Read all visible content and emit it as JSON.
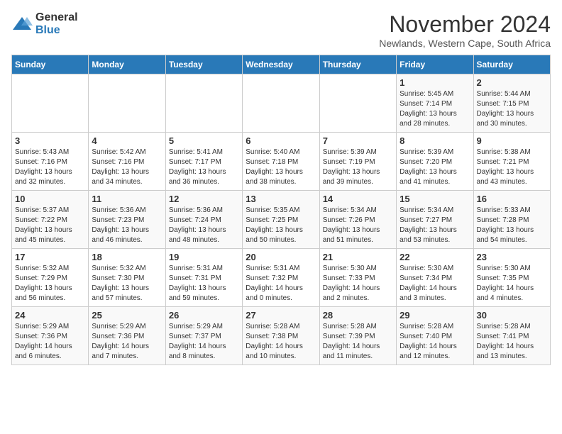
{
  "header": {
    "logo_general": "General",
    "logo_blue": "Blue",
    "month": "November 2024",
    "location": "Newlands, Western Cape, South Africa"
  },
  "days_of_week": [
    "Sunday",
    "Monday",
    "Tuesday",
    "Wednesday",
    "Thursday",
    "Friday",
    "Saturday"
  ],
  "weeks": [
    {
      "days": [
        {
          "number": "",
          "info": ""
        },
        {
          "number": "",
          "info": ""
        },
        {
          "number": "",
          "info": ""
        },
        {
          "number": "",
          "info": ""
        },
        {
          "number": "",
          "info": ""
        },
        {
          "number": "1",
          "info": "Sunrise: 5:45 AM\nSunset: 7:14 PM\nDaylight: 13 hours\nand 28 minutes."
        },
        {
          "number": "2",
          "info": "Sunrise: 5:44 AM\nSunset: 7:15 PM\nDaylight: 13 hours\nand 30 minutes."
        }
      ]
    },
    {
      "days": [
        {
          "number": "3",
          "info": "Sunrise: 5:43 AM\nSunset: 7:16 PM\nDaylight: 13 hours\nand 32 minutes."
        },
        {
          "number": "4",
          "info": "Sunrise: 5:42 AM\nSunset: 7:16 PM\nDaylight: 13 hours\nand 34 minutes."
        },
        {
          "number": "5",
          "info": "Sunrise: 5:41 AM\nSunset: 7:17 PM\nDaylight: 13 hours\nand 36 minutes."
        },
        {
          "number": "6",
          "info": "Sunrise: 5:40 AM\nSunset: 7:18 PM\nDaylight: 13 hours\nand 38 minutes."
        },
        {
          "number": "7",
          "info": "Sunrise: 5:39 AM\nSunset: 7:19 PM\nDaylight: 13 hours\nand 39 minutes."
        },
        {
          "number": "8",
          "info": "Sunrise: 5:39 AM\nSunset: 7:20 PM\nDaylight: 13 hours\nand 41 minutes."
        },
        {
          "number": "9",
          "info": "Sunrise: 5:38 AM\nSunset: 7:21 PM\nDaylight: 13 hours\nand 43 minutes."
        }
      ]
    },
    {
      "days": [
        {
          "number": "10",
          "info": "Sunrise: 5:37 AM\nSunset: 7:22 PM\nDaylight: 13 hours\nand 45 minutes."
        },
        {
          "number": "11",
          "info": "Sunrise: 5:36 AM\nSunset: 7:23 PM\nDaylight: 13 hours\nand 46 minutes."
        },
        {
          "number": "12",
          "info": "Sunrise: 5:36 AM\nSunset: 7:24 PM\nDaylight: 13 hours\nand 48 minutes."
        },
        {
          "number": "13",
          "info": "Sunrise: 5:35 AM\nSunset: 7:25 PM\nDaylight: 13 hours\nand 50 minutes."
        },
        {
          "number": "14",
          "info": "Sunrise: 5:34 AM\nSunset: 7:26 PM\nDaylight: 13 hours\nand 51 minutes."
        },
        {
          "number": "15",
          "info": "Sunrise: 5:34 AM\nSunset: 7:27 PM\nDaylight: 13 hours\nand 53 minutes."
        },
        {
          "number": "16",
          "info": "Sunrise: 5:33 AM\nSunset: 7:28 PM\nDaylight: 13 hours\nand 54 minutes."
        }
      ]
    },
    {
      "days": [
        {
          "number": "17",
          "info": "Sunrise: 5:32 AM\nSunset: 7:29 PM\nDaylight: 13 hours\nand 56 minutes."
        },
        {
          "number": "18",
          "info": "Sunrise: 5:32 AM\nSunset: 7:30 PM\nDaylight: 13 hours\nand 57 minutes."
        },
        {
          "number": "19",
          "info": "Sunrise: 5:31 AM\nSunset: 7:31 PM\nDaylight: 13 hours\nand 59 minutes."
        },
        {
          "number": "20",
          "info": "Sunrise: 5:31 AM\nSunset: 7:32 PM\nDaylight: 14 hours\nand 0 minutes."
        },
        {
          "number": "21",
          "info": "Sunrise: 5:30 AM\nSunset: 7:33 PM\nDaylight: 14 hours\nand 2 minutes."
        },
        {
          "number": "22",
          "info": "Sunrise: 5:30 AM\nSunset: 7:34 PM\nDaylight: 14 hours\nand 3 minutes."
        },
        {
          "number": "23",
          "info": "Sunrise: 5:30 AM\nSunset: 7:35 PM\nDaylight: 14 hours\nand 4 minutes."
        }
      ]
    },
    {
      "days": [
        {
          "number": "24",
          "info": "Sunrise: 5:29 AM\nSunset: 7:36 PM\nDaylight: 14 hours\nand 6 minutes."
        },
        {
          "number": "25",
          "info": "Sunrise: 5:29 AM\nSunset: 7:36 PM\nDaylight: 14 hours\nand 7 minutes."
        },
        {
          "number": "26",
          "info": "Sunrise: 5:29 AM\nSunset: 7:37 PM\nDaylight: 14 hours\nand 8 minutes."
        },
        {
          "number": "27",
          "info": "Sunrise: 5:28 AM\nSunset: 7:38 PM\nDaylight: 14 hours\nand 10 minutes."
        },
        {
          "number": "28",
          "info": "Sunrise: 5:28 AM\nSunset: 7:39 PM\nDaylight: 14 hours\nand 11 minutes."
        },
        {
          "number": "29",
          "info": "Sunrise: 5:28 AM\nSunset: 7:40 PM\nDaylight: 14 hours\nand 12 minutes."
        },
        {
          "number": "30",
          "info": "Sunrise: 5:28 AM\nSunset: 7:41 PM\nDaylight: 14 hours\nand 13 minutes."
        }
      ]
    }
  ]
}
